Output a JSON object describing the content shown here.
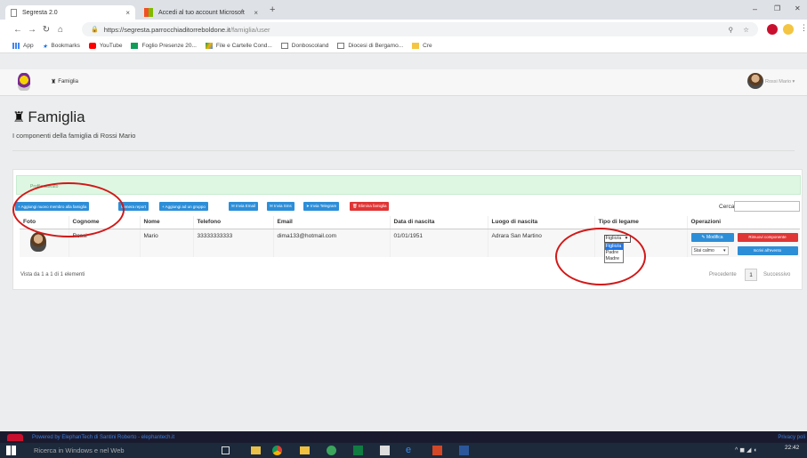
{
  "browser": {
    "tabs": [
      {
        "title": "Segresta 2.0",
        "close": "×"
      },
      {
        "title": "Accedi al tuo account Microsoft",
        "close": "×"
      }
    ],
    "new_tab": "+",
    "window_controls": {
      "minimize": "–",
      "maximize": "❐",
      "close": "✕"
    },
    "url": "https://segresta.parrocchiaditorreboldone.it/famiglia/user",
    "url_host": "https://segresta.parrocchiaditorreboldone.it",
    "url_path": "/famiglia/user",
    "bookmarks": [
      "App",
      "Bookmarks",
      "YouTube",
      "Foglio Presenze 20...",
      "File e Cartelle Cond...",
      "Donboscoland",
      "Diocesi di Bergamo...",
      "Cre"
    ]
  },
  "app": {
    "nav_item": "Famiglia",
    "user_menu": "Rossi Mario ▾",
    "page_title": "Famiglia",
    "page_subtitle": "I componenti della famiglia di Rossi Mario",
    "alert_text": "Profilo salvato",
    "actions": [
      {
        "label": "+ Aggiungi nuovo membro alla famiglia",
        "color": "blue"
      },
      {
        "label": "Genera report",
        "color": "blue"
      },
      {
        "label": "+ Aggiungi ad un gruppo",
        "color": "blue"
      },
      {
        "label": "✉ Invia Email",
        "color": "blue"
      },
      {
        "label": "✉ Invia Sms",
        "color": "blue"
      },
      {
        "label": "➤ Invia Telegram",
        "color": "blue"
      },
      {
        "label": "🗑 Elimina famiglia",
        "color": "red"
      }
    ],
    "search_label": "Cerca:",
    "search_value": "",
    "table": {
      "headers": [
        "Foto",
        "Cognome",
        "Nome",
        "Telefono",
        "Email",
        "Data di nascita",
        "Luogo di nascita",
        "Tipo di legame",
        "Operazioni"
      ],
      "rows": [
        {
          "cognome": "Rossi",
          "nome": "Mario",
          "telefono": "33333333333",
          "email": "dima133@hotmail.com",
          "data_nascita": "01/01/1951",
          "luogo_nascita": "Adrara San Martino",
          "legame_selected": "Figlio/a",
          "legame_options": [
            "Figlio/a",
            "Padre",
            "Madre"
          ],
          "stato": "Stai calmo",
          "modifica": "✎ Modifica",
          "rimuovi": "Rimuovi componente",
          "iscrivi": "Iscrivi all'evento"
        }
      ]
    },
    "info_text": "Vista da 1 a 1 di 1 elementi",
    "pagination": {
      "prev": "Precedente",
      "page": "1",
      "next": "Successivo"
    },
    "footer_text": "Powered by ElephanTech di Santini Roberto - elephantech.it",
    "footer_privacy": "Privacy poli"
  },
  "taskbar": {
    "search": "Ricerca in Windows e nel Web",
    "time": "22:42"
  },
  "colors": {
    "primary": "#2d8ed8",
    "danger": "#e03535",
    "annotation": "#d21818",
    "alert_bg": "#def7e3"
  }
}
